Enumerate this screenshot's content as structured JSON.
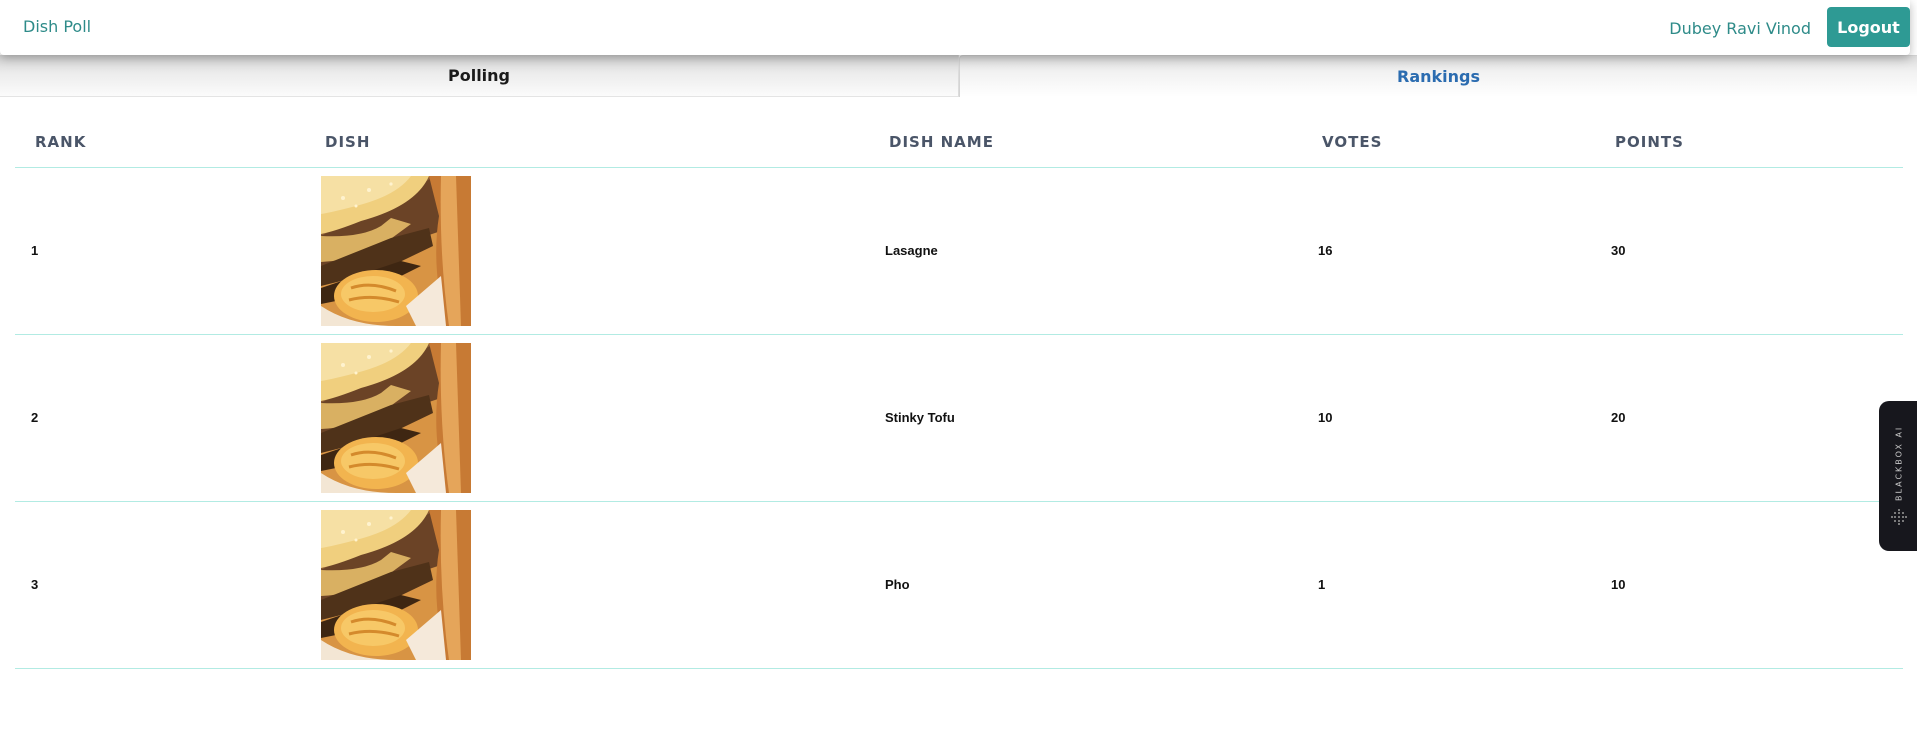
{
  "navbar": {
    "brand": "Dish Poll",
    "user_name": "Dubey Ravi Vinod",
    "logout_label": "Logout"
  },
  "tabs": [
    {
      "label": "Polling",
      "active": false
    },
    {
      "label": "Rankings",
      "active": true
    }
  ],
  "table": {
    "headers": {
      "rank": "RANK",
      "dish": "DISH",
      "dish_name": "DISH NAME",
      "votes": "VOTES",
      "points": "POINTS"
    },
    "rows": [
      {
        "rank": "1",
        "dish_name": "Lasagne",
        "votes": "16",
        "points": "30"
      },
      {
        "rank": "2",
        "dish_name": "Stinky Tofu",
        "votes": "10",
        "points": "20"
      },
      {
        "rank": "3",
        "dish_name": "Pho",
        "votes": "1",
        "points": "10"
      }
    ]
  },
  "side_widget": {
    "label": "BLACKBOX AI"
  },
  "colors": {
    "accent": "#2e9a94",
    "link_blue": "#2b6cb0",
    "row_border": "#b2ebe3"
  }
}
